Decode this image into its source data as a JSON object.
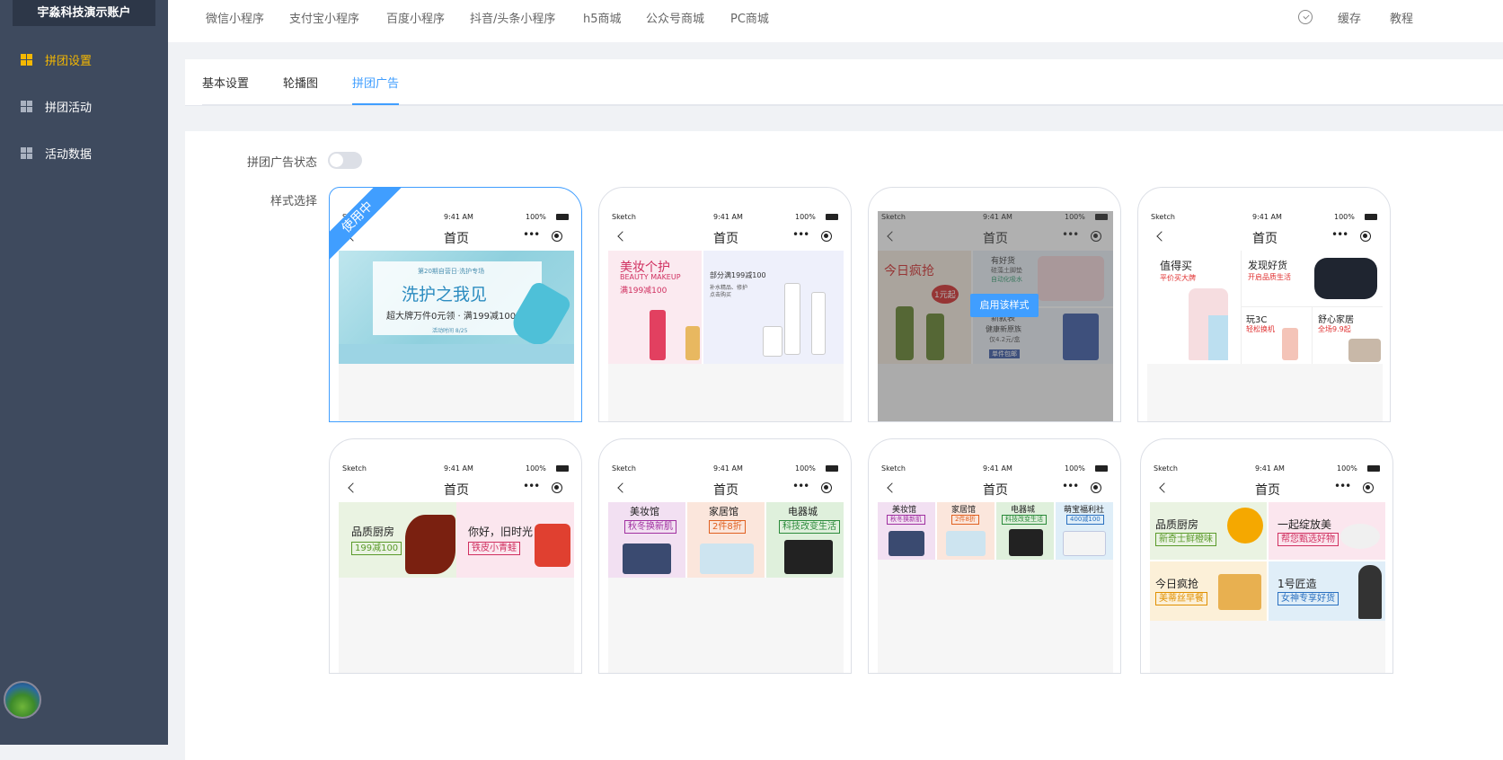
{
  "sidebar": {
    "account": "宇淼科技演示账户",
    "items": [
      {
        "label": "拼团设置"
      },
      {
        "label": "拼团活动"
      },
      {
        "label": "活动数据"
      }
    ]
  },
  "topbar": {
    "tabs": [
      {
        "label": "微信小程序"
      },
      {
        "label": "支付宝小程序"
      },
      {
        "label": "百度小程序"
      },
      {
        "label": "抖音/头条小程序"
      },
      {
        "label": "h5商城"
      },
      {
        "label": "公众号商城"
      },
      {
        "label": "PC商城"
      }
    ],
    "cache": "缓存",
    "tutorial": "教程"
  },
  "subtabs": [
    {
      "label": "基本设置"
    },
    {
      "label": "轮播图"
    },
    {
      "label": "拼团广告"
    }
  ],
  "form": {
    "status_label": "拼团广告状态",
    "style_label": "样式选择",
    "in_use": "使用中",
    "enable": "启用该样式"
  },
  "phone": {
    "carrier": "Sketch",
    "time": "9:41 AM",
    "battery": "100%",
    "title": "首页"
  },
  "ads": {
    "a1": {
      "top": "第20期自营日·洗护专场",
      "title": "洗护之我见",
      "sub": "超大牌万件0元领 · 满199减100",
      "foot": "活动时间 8/25"
    },
    "a2": {
      "title": "美妆个护",
      "en": "BEAUTY MAKEUP",
      "promo": "满199减100",
      "right1": "部分满199减100",
      "right2": "补水精品、修护",
      "right3": "点击购买"
    },
    "a3": {
      "left": "今日疯抢",
      "badge": "1元起",
      "r1": "有好货",
      "r2": "硅藻土脚垫",
      "r3": "自动化吸水",
      "r4": "新款表",
      "r5": "健康新原族",
      "r6": "仅4.2元/盒",
      "r7": "单件包邮"
    },
    "a4": {
      "c1": "值得买",
      "c1s": "平价买大牌",
      "c2": "发现好货",
      "c2s": "开启品质生活",
      "c3": "玩3C",
      "c3s": "轻松换机",
      "c4": "舒心家居",
      "c4s": "全场9.9起"
    },
    "a5": {
      "c1": "品质厨房",
      "c1t": "199减100",
      "c2": "你好，旧时光",
      "c2t": "铁皮小青蛙"
    },
    "a6": {
      "c1": "美妆馆",
      "c1t": "秋冬换新肌",
      "c2": "家居馆",
      "c2t": "2件8折",
      "c3": "电器城",
      "c3t": "科技改变生活"
    },
    "a7": {
      "c1": "美妆馆",
      "c1t": "秋冬换新肌",
      "c2": "家居馆",
      "c2t": "2件8折",
      "c3": "电器城",
      "c3t": "科技改变生活",
      "c4": "萌宝福利社",
      "c4t": "400减100"
    },
    "a8": {
      "c1": "品质厨房",
      "c1t": "新奇士鲜橙味",
      "c2": "一起绽放美",
      "c2t": "帮您甄选好物",
      "c3": "今日疯抢",
      "c3t": "美蒂丝早餐",
      "c4": "1号匠造",
      "c4t": "女神专享好货"
    }
  }
}
